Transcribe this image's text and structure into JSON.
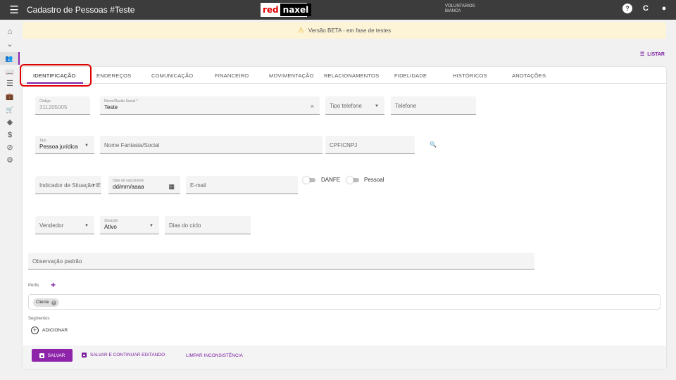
{
  "appbar": {
    "menu_icon": "☰",
    "title": "Cadastro de Pessoas #Teste",
    "logo_red": "red",
    "logo_dark": "naxel",
    "user_line1": "VOLUNTARIOS",
    "user_line2": "BIANCA",
    "help_icon": "?",
    "refresh_icon": "C",
    "account_icon": "●"
  },
  "banner": {
    "text": "Versão BETA - em fase de testes",
    "icon": "⚠"
  },
  "listar": {
    "label": "LISTAR",
    "icon": "☰"
  },
  "sidebar": {
    "icons": [
      "⌂",
      "⌄",
      "👥",
      "📖",
      "☰",
      "💼",
      "🛒",
      "◆",
      "$",
      "⊘",
      "⚙"
    ]
  },
  "tabs": [
    "IDENTIFICAÇÃO",
    "ENDEREÇOS",
    "COMUNICAÇÃO",
    "FINANCEIRO",
    "MOVIMENTAÇÃO",
    "RELACIONAMENTOS",
    "FIDELIDADE",
    "HISTÓRICOS",
    "ANOTAÇÕES"
  ],
  "form": {
    "codigo": {
      "label": "Código",
      "value": "311205005"
    },
    "nome": {
      "label": "Nome/Razão Social *",
      "value": "Teste",
      "clear": "×"
    },
    "tipo_telefone": {
      "placeholder": "Tipo telefone",
      "arrow": "▼"
    },
    "telefone": {
      "placeholder": "Telefone"
    },
    "tipo": {
      "label": "Tipo",
      "value": "Pessoa jurídica",
      "arrow": "▼"
    },
    "nome_fantasia": {
      "placeholder": "Nome Fantasia/Social"
    },
    "cpf_cnpj": {
      "placeholder": "CPF/CNPJ"
    },
    "search_icon": "🔍",
    "indicador": {
      "placeholder": "Indicador de Situação IE",
      "arrow": "▼"
    },
    "nascimento": {
      "label": "Data de nascimento",
      "value": "dd/mm/aaaa",
      "icon": "▦"
    },
    "email": {
      "placeholder": "E-mail"
    },
    "danfe": "DANFE",
    "pessoal": "Pessoal",
    "vendedor": {
      "placeholder": "Vendedor",
      "arrow": "▼"
    },
    "situacao": {
      "label": "Situação",
      "value": "Ativo",
      "arrow": "▼"
    },
    "dias_ciclo": {
      "placeholder": "Dias do ciclo"
    },
    "observacao": {
      "placeholder": "Observação padrão"
    },
    "perfis_label": "Perfis",
    "perfis_add": "+",
    "chip": "Cliente",
    "chip_x": "×",
    "segmentos_label": "Segmentos",
    "adicionar": "ADICIONAR",
    "adicionar_icon": "+"
  },
  "footer": {
    "salvar": "SALVAR",
    "salvar_continuar": "SALVAR E CONTINUAR EDITANDO",
    "limpar": "LIMPAR INCONSISTÊNCIA"
  }
}
